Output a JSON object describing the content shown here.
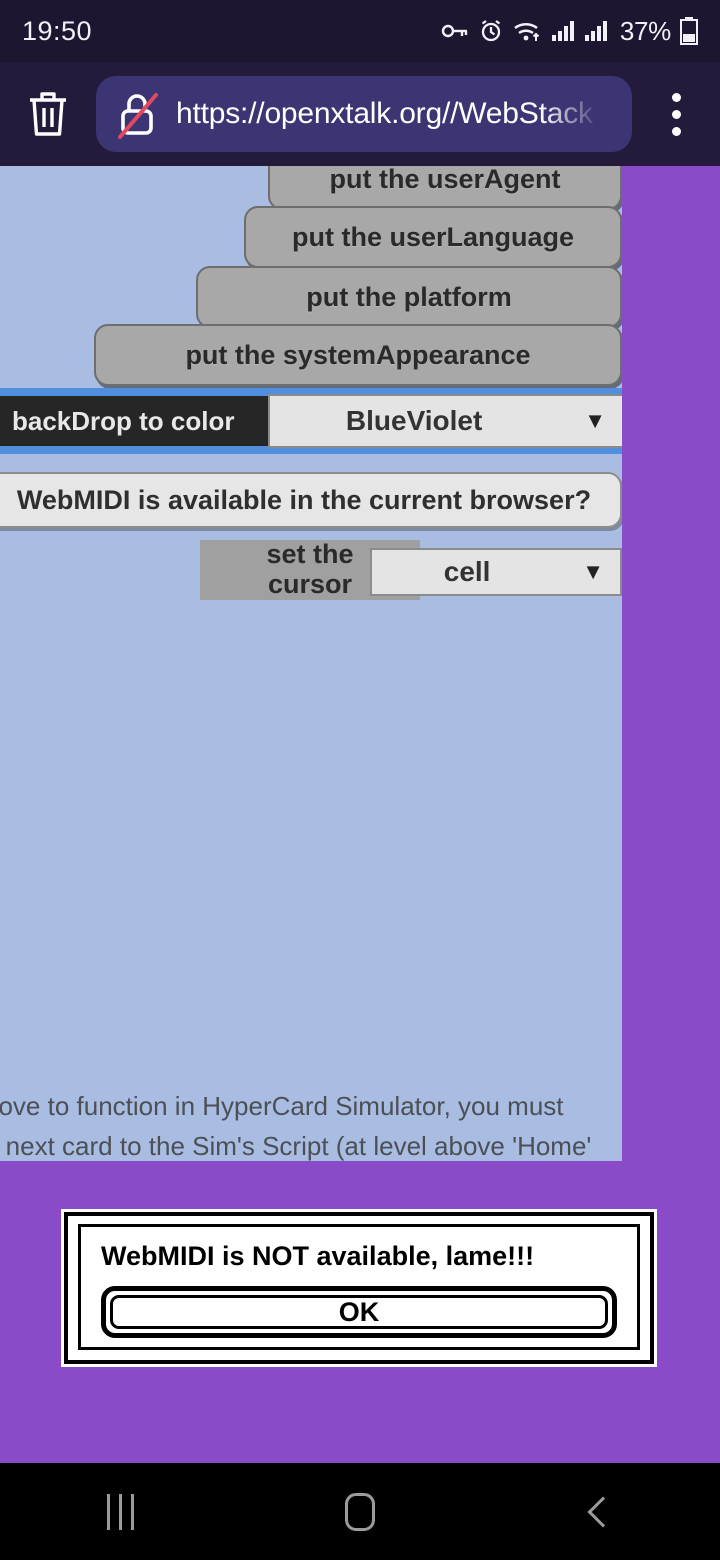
{
  "status_bar": {
    "time": "19:50",
    "battery_percent": "37%",
    "icons": [
      "vpn-key-icon",
      "alarm-icon",
      "wifi-icon",
      "signal-1-icon",
      "signal-2-icon",
      "battery-icon"
    ]
  },
  "browser": {
    "trash_icon": "trash-icon",
    "security_icon": "lock-crossed-out-icon",
    "url": "https://openxtalk.org//WebStack",
    "menu_icon": "overflow-menu-icon"
  },
  "webview": {
    "backdrop_color_hex": "#8A4BC8",
    "card_color_hex": "#A9BDE2",
    "blue_strip_hex": "#4F8FDE",
    "buttons": [
      {
        "label": "put the userAgent"
      },
      {
        "label": "put the userLanguage"
      },
      {
        "label": "put the platform"
      },
      {
        "label": "put the systemAppearance"
      }
    ],
    "backdrop_row": {
      "label": "backDrop to color",
      "selected": "BlueViolet",
      "caret": "▼"
    },
    "webmidi_button": {
      "label": "WebMIDI is available in the current browser?"
    },
    "cursor_row": {
      "label_line1": "set the",
      "label_line2": "cursor",
      "selected": "cell",
      "caret": "▼"
    },
    "card_icon_button": "card-document-icon",
    "footnote": {
      "line1": "bove to function in HyperCard Simulator, you must",
      "line2": "e next card to the Sim's Script (at level above 'Home'"
    }
  },
  "alert": {
    "message": "WebMIDI is NOT available, lame!!!",
    "ok_label": "OK"
  },
  "nav_bar": {
    "recents_icon": "recents-icon",
    "home_icon": "home-icon",
    "back_icon": "back-icon"
  }
}
